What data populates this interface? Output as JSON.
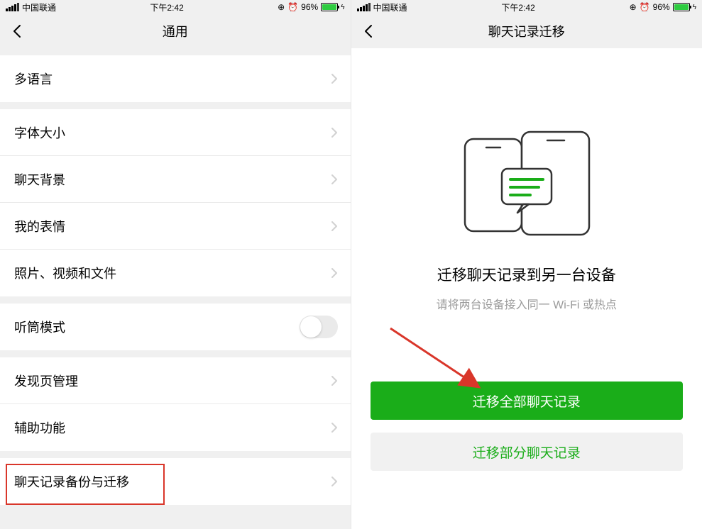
{
  "status": {
    "carrier": "中国联通",
    "time": "下午2:42",
    "battery_pct": "96%"
  },
  "left": {
    "title": "通用",
    "rows": {
      "lang": "多语言",
      "fontSize": "字体大小",
      "chatBg": "聊天背景",
      "stickers": "我的表情",
      "media": "照片、视频和文件",
      "receiver": "听筒模式",
      "discover": "发现页管理",
      "accessibility": "辅助功能",
      "backup": "聊天记录备份与迁移"
    }
  },
  "right": {
    "title": "聊天记录迁移",
    "headline": "迁移聊天记录到另一台设备",
    "hint": "请将两台设备接入同一 Wi-Fi 或热点",
    "btn_all": "迁移全部聊天记录",
    "btn_partial": "迁移部分聊天记录"
  },
  "status_right": {
    "time": "下午2:42"
  }
}
